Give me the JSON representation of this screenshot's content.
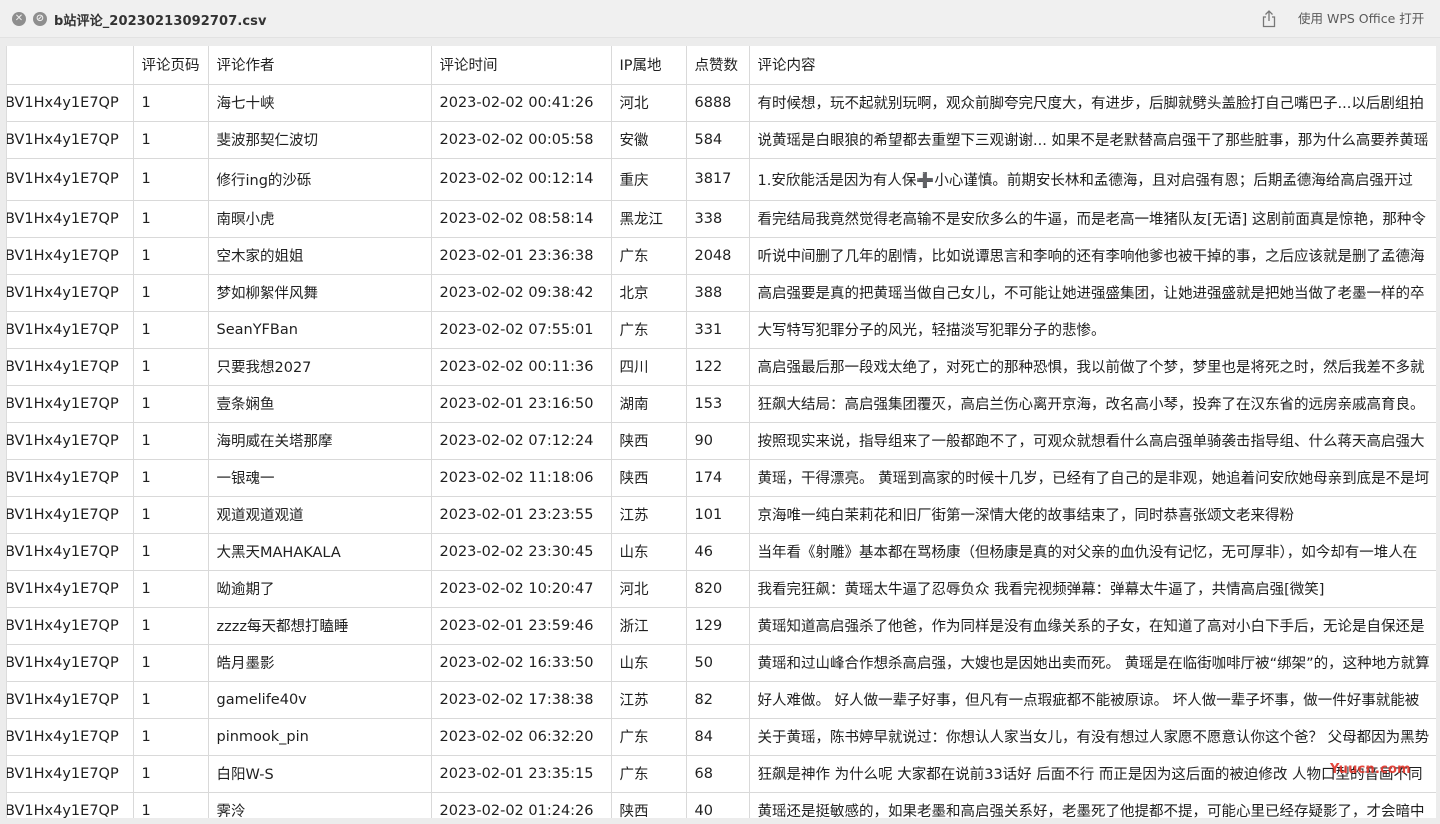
{
  "window": {
    "title": "b站评论_20230213092707.csv",
    "open_with_label": "使用 WPS Office 打开",
    "close_icon": "close-icon",
    "minimize_icon": "minimize-icon",
    "share_icon": "share-icon"
  },
  "table": {
    "headers": [
      "",
      "评论页码",
      "评论作者",
      "评论时间",
      "IP属地",
      "点赞数",
      "评论内容"
    ],
    "rows": [
      [
        "BV1Hx4y1E7QP",
        "1",
        "海七十峡",
        "2023-02-02 00:41:26",
        "河北",
        "6888",
        "有时候想，玩不起就别玩啊，观众前脚夸完尺度大，有进步，后脚就劈头盖脸打自己嘴巴子...以后剧组拍"
      ],
      [
        "BV1Hx4y1E7QP",
        "1",
        "斐波那契仁波切",
        "2023-02-02 00:05:58",
        "安徽",
        "584",
        "说黄瑶是白眼狼的希望都去重塑下三观谢谢... 如果不是老默替高启强干了那些脏事，那为什么高要养黄瑶"
      ],
      [
        "BV1Hx4y1E7QP",
        "1",
        "修行ing的沙砾",
        "2023-02-02 00:12:14",
        "重庆",
        "3817",
        "1.安欣能活是因为有人保➕小心谨慎。前期安长林和孟德海，且对启强有恩；后期孟德海给高启强开过"
      ],
      [
        "BV1Hx4y1E7QP",
        "1",
        "南暝小虎",
        "2023-02-02 08:58:14",
        "黑龙江",
        "338",
        "看完结局我竟然觉得老高输不是安欣多么的牛逼，而是老高一堆猪队友[无语] 这剧前面真是惊艳，那种令"
      ],
      [
        "BV1Hx4y1E7QP",
        "1",
        "空木家的姐姐",
        "2023-02-01 23:36:38",
        "广东",
        "2048",
        "听说中间删了几年的剧情，比如说谭思言和李响的还有李响他爹也被干掉的事，之后应该就是删了孟德海"
      ],
      [
        "BV1Hx4y1E7QP",
        "1",
        "梦如柳絮伴风舞",
        "2023-02-02 09:38:42",
        "北京",
        "388",
        "高启强要是真的把黄瑶当做自己女儿，不可能让她进强盛集团，让她进强盛就是把她当做了老墨一样的卒"
      ],
      [
        "BV1Hx4y1E7QP",
        "1",
        "SeanYFBan",
        "2023-02-02 07:55:01",
        "广东",
        "331",
        "大写特写犯罪分子的风光，轻描淡写犯罪分子的悲惨。"
      ],
      [
        "BV1Hx4y1E7QP",
        "1",
        "只要我想2027",
        "2023-02-02 00:11:36",
        "四川",
        "122",
        "高启强最后那一段戏太绝了，对死亡的那种恐惧，我以前做了个梦，梦里也是将死之时，然后我差不多就"
      ],
      [
        "BV1Hx4y1E7QP",
        "1",
        "壹条娴鱼",
        "2023-02-01 23:16:50",
        "湖南",
        "153",
        "狂飙大结局：高启强集团覆灭，高启兰伤心离开京海，改名高小琴，投奔了在汉东省的远房亲戚高育良。"
      ],
      [
        "BV1Hx4y1E7QP",
        "1",
        "海明威在关塔那摩",
        "2023-02-02 07:12:24",
        "陕西",
        "90",
        "按照现实来说，指导组来了一般都跑不了，可观众就想看什么高启强单骑袭击指导组、什么蒋天高启强大"
      ],
      [
        "BV1Hx4y1E7QP",
        "1",
        "一银魂一",
        "2023-02-02 11:18:06",
        "陕西",
        "174",
        "黄瑶，干得漂亮。 黄瑶到高家的时候十几岁，已经有了自己的是非观，她追着问安欣她母亲到底是不是坷"
      ],
      [
        "BV1Hx4y1E7QP",
        "1",
        "观道观道观道",
        "2023-02-01 23:23:55",
        "江苏",
        "101",
        "京海唯一纯白茉莉花和旧厂街第一深情大佬的故事结束了，同时恭喜张颂文老来得粉"
      ],
      [
        "BV1Hx4y1E7QP",
        "1",
        "大黑天MAHAKALA",
        "2023-02-02 23:30:45",
        "山东",
        "46",
        "当年看《射雕》基本都在骂杨康（但杨康是真的对父亲的血仇没有记忆，无可厚非），如今却有一堆人在"
      ],
      [
        "BV1Hx4y1E7QP",
        "1",
        "呦逾期了",
        "2023-02-02 10:20:47",
        "河北",
        "820",
        "我看完狂飙：黄瑶太牛逼了忍辱负众 我看完视频弹幕：弹幕太牛逼了，共情高启强[微笑]"
      ],
      [
        "BV1Hx4y1E7QP",
        "1",
        "zzzz每天都想打瞌睡",
        "2023-02-01 23:59:46",
        "浙江",
        "129",
        "黄瑶知道高启强杀了他爸，作为同样是没有血缘关系的子女，在知道了高对小白下手后，无论是自保还是"
      ],
      [
        "BV1Hx4y1E7QP",
        "1",
        "皓月墨影",
        "2023-02-02 16:33:50",
        "山东",
        "50",
        "黄瑶和过山峰合作想杀高启强，大嫂也是因她出卖而死。 黄瑶是在临街咖啡厅被“绑架”的，这种地方就算"
      ],
      [
        "BV1Hx4y1E7QP",
        "1",
        "gamelife40v",
        "2023-02-02 17:38:38",
        "江苏",
        "82",
        "好人难做。 好人做一辈子好事，但凡有一点瑕疵都不能被原谅。 坏人做一辈子坏事，做一件好事就能被"
      ],
      [
        "BV1Hx4y1E7QP",
        "1",
        "pinmook_pin",
        "2023-02-02 06:32:20",
        "广东",
        "84",
        "关于黄瑶，陈书婷早就说过：你想认人家当女儿，有没有想过人家愿不愿意认你这个爸？ 父母都因为黑势"
      ],
      [
        "BV1Hx4y1E7QP",
        "1",
        "白阳W-S",
        "2023-02-01 23:35:15",
        "广东",
        "68",
        "狂飙是神作 为什么呢 大家都在说前33话好 后面不行 而正是因为这后面的被迫修改 人物口型的音画不同"
      ],
      [
        "BV1Hx4y1E7QP",
        "1",
        "霁泠",
        "2023-02-02 01:24:26",
        "陕西",
        "40",
        "黄瑶还是挺敏感的，如果老墨和高启强关系好，老墨死了他提都不提，可能心里已经存疑影了，才会暗中"
      ]
    ]
  },
  "watermark": "Yuucn.com"
}
